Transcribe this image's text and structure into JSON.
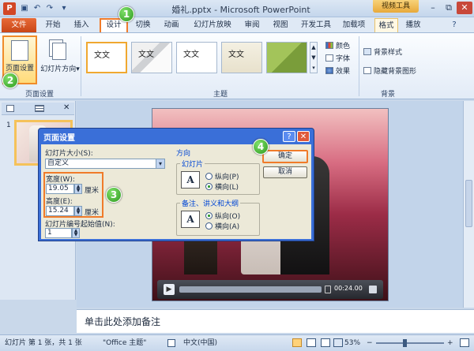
{
  "window": {
    "title": "婚礼.pptx - Microsoft PowerPoint",
    "tool_context": "视频工具",
    "app_icon": "P",
    "qa_symbols": {
      "save": "▣",
      "undo": "↶",
      "redo": "↷",
      "customize": "▾"
    },
    "win_symbols": {
      "help": "?",
      "restore": "⧉",
      "minimize": "–",
      "close": "✕",
      "maximize": "□"
    }
  },
  "tabs": {
    "file": "文件",
    "start": "开始",
    "insert": "插入",
    "design": "设计",
    "transition": "切换",
    "animation": "动画",
    "slideshow": "幻灯片放映",
    "review": "审阅",
    "view": "视图",
    "developer": "开发工具",
    "addins": "加载项",
    "format": "格式",
    "playback": "播放"
  },
  "ribbon": {
    "page_setup_button": "页面设置",
    "orientation_button": "幻灯片方向",
    "orientation_arrow": "▾",
    "group_page_setup": "页面设置",
    "group_themes": "主题",
    "group_background": "背景",
    "theme_label": "文文",
    "theme_scroll_symbols": [
      "▲",
      "▼",
      "▾"
    ],
    "colors": "颜色",
    "fonts": "字体",
    "effects": "效果",
    "bg_style": "背景样式",
    "hide_bg": "隐藏背景图形"
  },
  "slides_pane": {
    "slide_number": "1",
    "close_symbol": "✕"
  },
  "player": {
    "time": "00:24.00",
    "play_symbol": "▶"
  },
  "notes": {
    "placeholder": "单击此处添加备注"
  },
  "status": {
    "slide_info": "幻灯片 第 1 张，共 1 张",
    "theme": "\"Office 主题\"",
    "language": "中文(中国)",
    "zoom": "53%",
    "zoom_minus": "−",
    "zoom_plus": "+"
  },
  "dialog": {
    "title": "页面设置",
    "help_symbol": "?",
    "close_symbol": "✕",
    "size_label": "幻灯片大小(S):",
    "size_value": "自定义",
    "dropdown_symbol": "▾",
    "width_label": "宽度(W):",
    "width_value": "19.05",
    "height_label": "高度(E):",
    "height_value": "15.24",
    "unit": "厘米",
    "start_label": "幻灯片编号起始值(N):",
    "start_value": "1",
    "spin_symbols": [
      "▲",
      "▼"
    ],
    "orientation_title": "方向",
    "slides_group": "幻灯片",
    "portrait_slides": "纵向(P)",
    "landscape_slides": "横向(L)",
    "notes_group": "备注、讲义和大纲",
    "portrait_notes": "纵向(O)",
    "landscape_notes": "横向(A)",
    "orient_icon_glyph": "A",
    "ok": "确定",
    "cancel": "取消"
  },
  "badges": [
    "1",
    "2",
    "3",
    "4"
  ],
  "colors": {
    "accent_orange": "#f07b2a",
    "file_tab": "#c94617",
    "dialog_blue": "#3a6fd8",
    "badge_green": "#2f9a1f"
  }
}
